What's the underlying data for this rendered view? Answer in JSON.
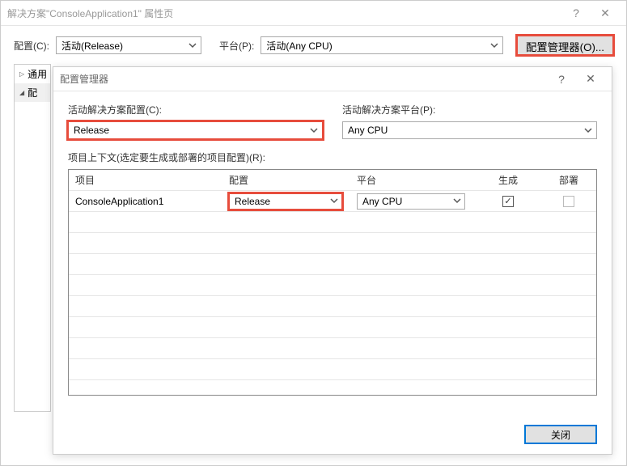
{
  "parent": {
    "title": "解决方案\"ConsoleApplication1\" 属性页",
    "help_icon": "?",
    "close_icon": "✕",
    "config_label": "配置(C):",
    "config_value": "活动(Release)",
    "platform_label": "平台(P):",
    "platform_value": "活动(Any CPU)",
    "config_manager_btn": "配置管理器(O)...",
    "tree": {
      "item1": "通用",
      "item2": "配"
    }
  },
  "child": {
    "title": "配置管理器",
    "help_icon": "?",
    "close_icon": "✕",
    "solution_config_label": "活动解决方案配置(C):",
    "solution_config_value": "Release",
    "solution_platform_label": "活动解决方案平台(P):",
    "solution_platform_value": "Any CPU",
    "hint": "项目上下文(选定要生成或部署的项目配置)(R):",
    "columns": {
      "project": "项目",
      "config": "配置",
      "platform": "平台",
      "build": "生成",
      "deploy": "部署"
    },
    "row1": {
      "project": "ConsoleApplication1",
      "config": "Release",
      "platform": "Any CPU",
      "build_checked": "✓",
      "deploy_checked": ""
    },
    "close_btn": "关闭"
  }
}
